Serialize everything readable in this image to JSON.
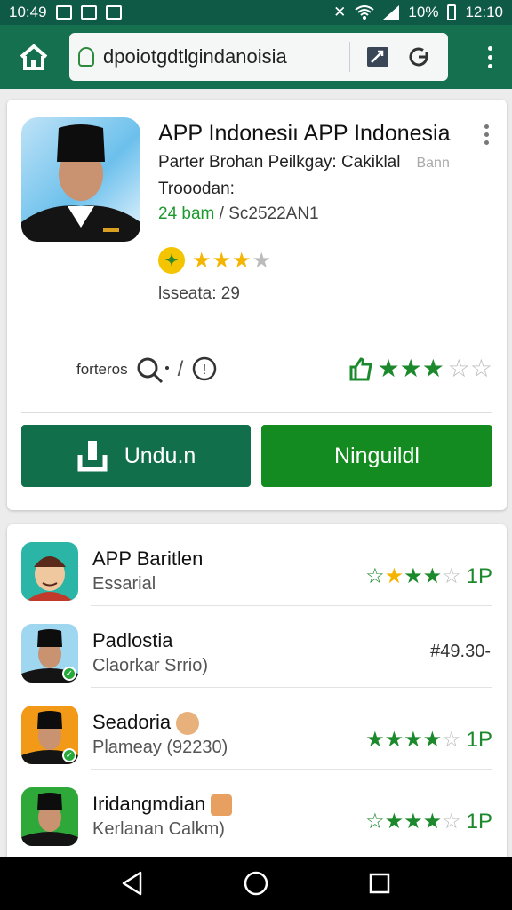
{
  "status_bar": {
    "time_left": "10:49",
    "battery": "10%",
    "time_right": "12:10"
  },
  "browser": {
    "url": "dpoiotgdtlgindanoisia"
  },
  "app": {
    "title": "APP Indonesiı APP Indonesia",
    "developer": "Parter Brohan Peilkgay: Cakiklal",
    "developer_extra": "Bann",
    "category": "Trooodan:",
    "date_green": "24 bam",
    "date_rest": " / Sc2522AN1",
    "size": "lsseata: 29",
    "meta_label": "forteros",
    "rating_stars": 3,
    "install_button": "Undu.n",
    "other_button": "Ninguildl"
  },
  "list": [
    {
      "name": "APP Baritlen",
      "sub": "Essarial",
      "right": "1P",
      "icon_bg": "#2bb5a6"
    },
    {
      "name": "Padlostia",
      "sub": "Claorkar Srrio)",
      "price": "#49.30-",
      "icon_bg": "#9fd6f0"
    },
    {
      "name": "Seadoria",
      "sub": "Plameay (92230)",
      "right": "1P",
      "icon_bg": "#f29a18"
    },
    {
      "name": "Iridangmdian",
      "sub": "Kerlanan Calkm)",
      "right": "1P",
      "icon_bg": "#2fa83a"
    }
  ],
  "colors": {
    "header": "#14704f",
    "accent_green": "#138b20",
    "star_yellow": "#f4b400"
  }
}
